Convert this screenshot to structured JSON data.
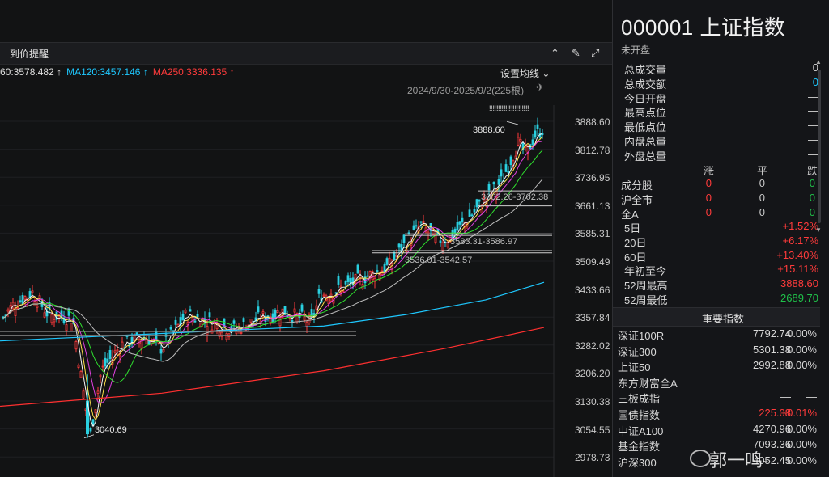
{
  "toolbar": {
    "title": "到价提醒",
    "close": "⌃",
    "brush": "✎",
    "expand": "⤢"
  },
  "ma_line": [
    {
      "text": "60:3578.482 ↑",
      "color": "#e0e0e0"
    },
    {
      "text": "MA120:3457.146 ↑",
      "color": "#1ec8ff"
    },
    {
      "text": "MA250:3336.135 ↑",
      "color": "#ff3b3b"
    }
  ],
  "settings_label": "设置均线 ⌄",
  "range_label": "2024/9/30-2025/9/2(225根)",
  "pin_icon": "✈",
  "y_ticks": [
    "3888.60",
    "3812.78",
    "3736.95",
    "3661.13",
    "3585.31",
    "3509.49",
    "3433.66",
    "3357.84",
    "3282.02",
    "3206.20",
    "3130.38",
    "3054.55",
    "2978.73"
  ],
  "annotations": {
    "high": "3888.60",
    "low": "3040.69",
    "band1": "3662.26-3702.38",
    "band2": "3583.31-3586.97",
    "band3": "3536.01-3542.57",
    "marks": "‼‼‼‼‼‼‼‼‼‼‼"
  },
  "side": {
    "title": "000001 上证指数",
    "status": "未开盘",
    "stats": [
      {
        "label": "总成交量",
        "value": "0",
        "cls": "dim"
      },
      {
        "label": "总成交额",
        "value": "0",
        "cls": "cyan"
      },
      {
        "label": "今日开盘",
        "value": "—",
        "cls": "dim"
      },
      {
        "label": "最高点位",
        "value": "—",
        "cls": "dim"
      },
      {
        "label": "最低点位",
        "value": "—",
        "cls": "dim"
      },
      {
        "label": "内盘总量",
        "value": "—",
        "cls": "dim"
      },
      {
        "label": "外盘总量",
        "value": "—",
        "cls": "dim"
      }
    ],
    "breadth_header": [
      "涨",
      "平",
      "跌"
    ],
    "breadth": [
      {
        "label": "成分股",
        "up": "0",
        "flat": "0",
        "down": "0"
      },
      {
        "label": "沪全市",
        "up": "0",
        "flat": "0",
        "down": "0"
      },
      {
        "label": "全A",
        "up": "0",
        "flat": "0",
        "down": "0"
      }
    ],
    "periods": [
      {
        "label": "5日",
        "value": "+1.52%",
        "cls": "red"
      },
      {
        "label": "20日",
        "value": "+6.17%",
        "cls": "red"
      },
      {
        "label": "60日",
        "value": "+13.40%",
        "cls": "red"
      },
      {
        "label": "年初至今",
        "value": "+15.11%",
        "cls": "red"
      },
      {
        "label": "52周最高",
        "value": "3888.60",
        "cls": "red"
      },
      {
        "label": "52周最低",
        "value": "2689.70",
        "cls": "green"
      }
    ],
    "section_title": "重要指数",
    "indices": [
      {
        "name": "深证100R",
        "price": "7792.74",
        "chg": "0.00%",
        "pc": "dim",
        "cc": "dim"
      },
      {
        "name": "深证300",
        "price": "5301.38",
        "chg": "0.00%",
        "pc": "dim",
        "cc": "dim"
      },
      {
        "name": "上证50",
        "price": "2992.88",
        "chg": "0.00%",
        "pc": "dim",
        "cc": "dim"
      },
      {
        "name": "东方财富全A",
        "price": "—",
        "chg": "—",
        "pc": "dim",
        "cc": "dim"
      },
      {
        "name": "三板成指",
        "price": "—",
        "chg": "—",
        "pc": "dim",
        "cc": "dim"
      },
      {
        "name": "国债指数",
        "price": "225.08",
        "chg": "+0.01%",
        "pc": "red",
        "cc": "red"
      },
      {
        "name": "中证A100",
        "price": "4270.96",
        "chg": "0.00%",
        "pc": "dim",
        "cc": "dim"
      },
      {
        "name": "基金指数",
        "price": "7093.36",
        "chg": "0.00%",
        "pc": "dim",
        "cc": "dim"
      },
      {
        "name": "沪深300",
        "price": "4052.45",
        "chg": "0.00%",
        "pc": "dim",
        "cc": "dim"
      }
    ]
  },
  "watermark": "郭一鸣-"
}
